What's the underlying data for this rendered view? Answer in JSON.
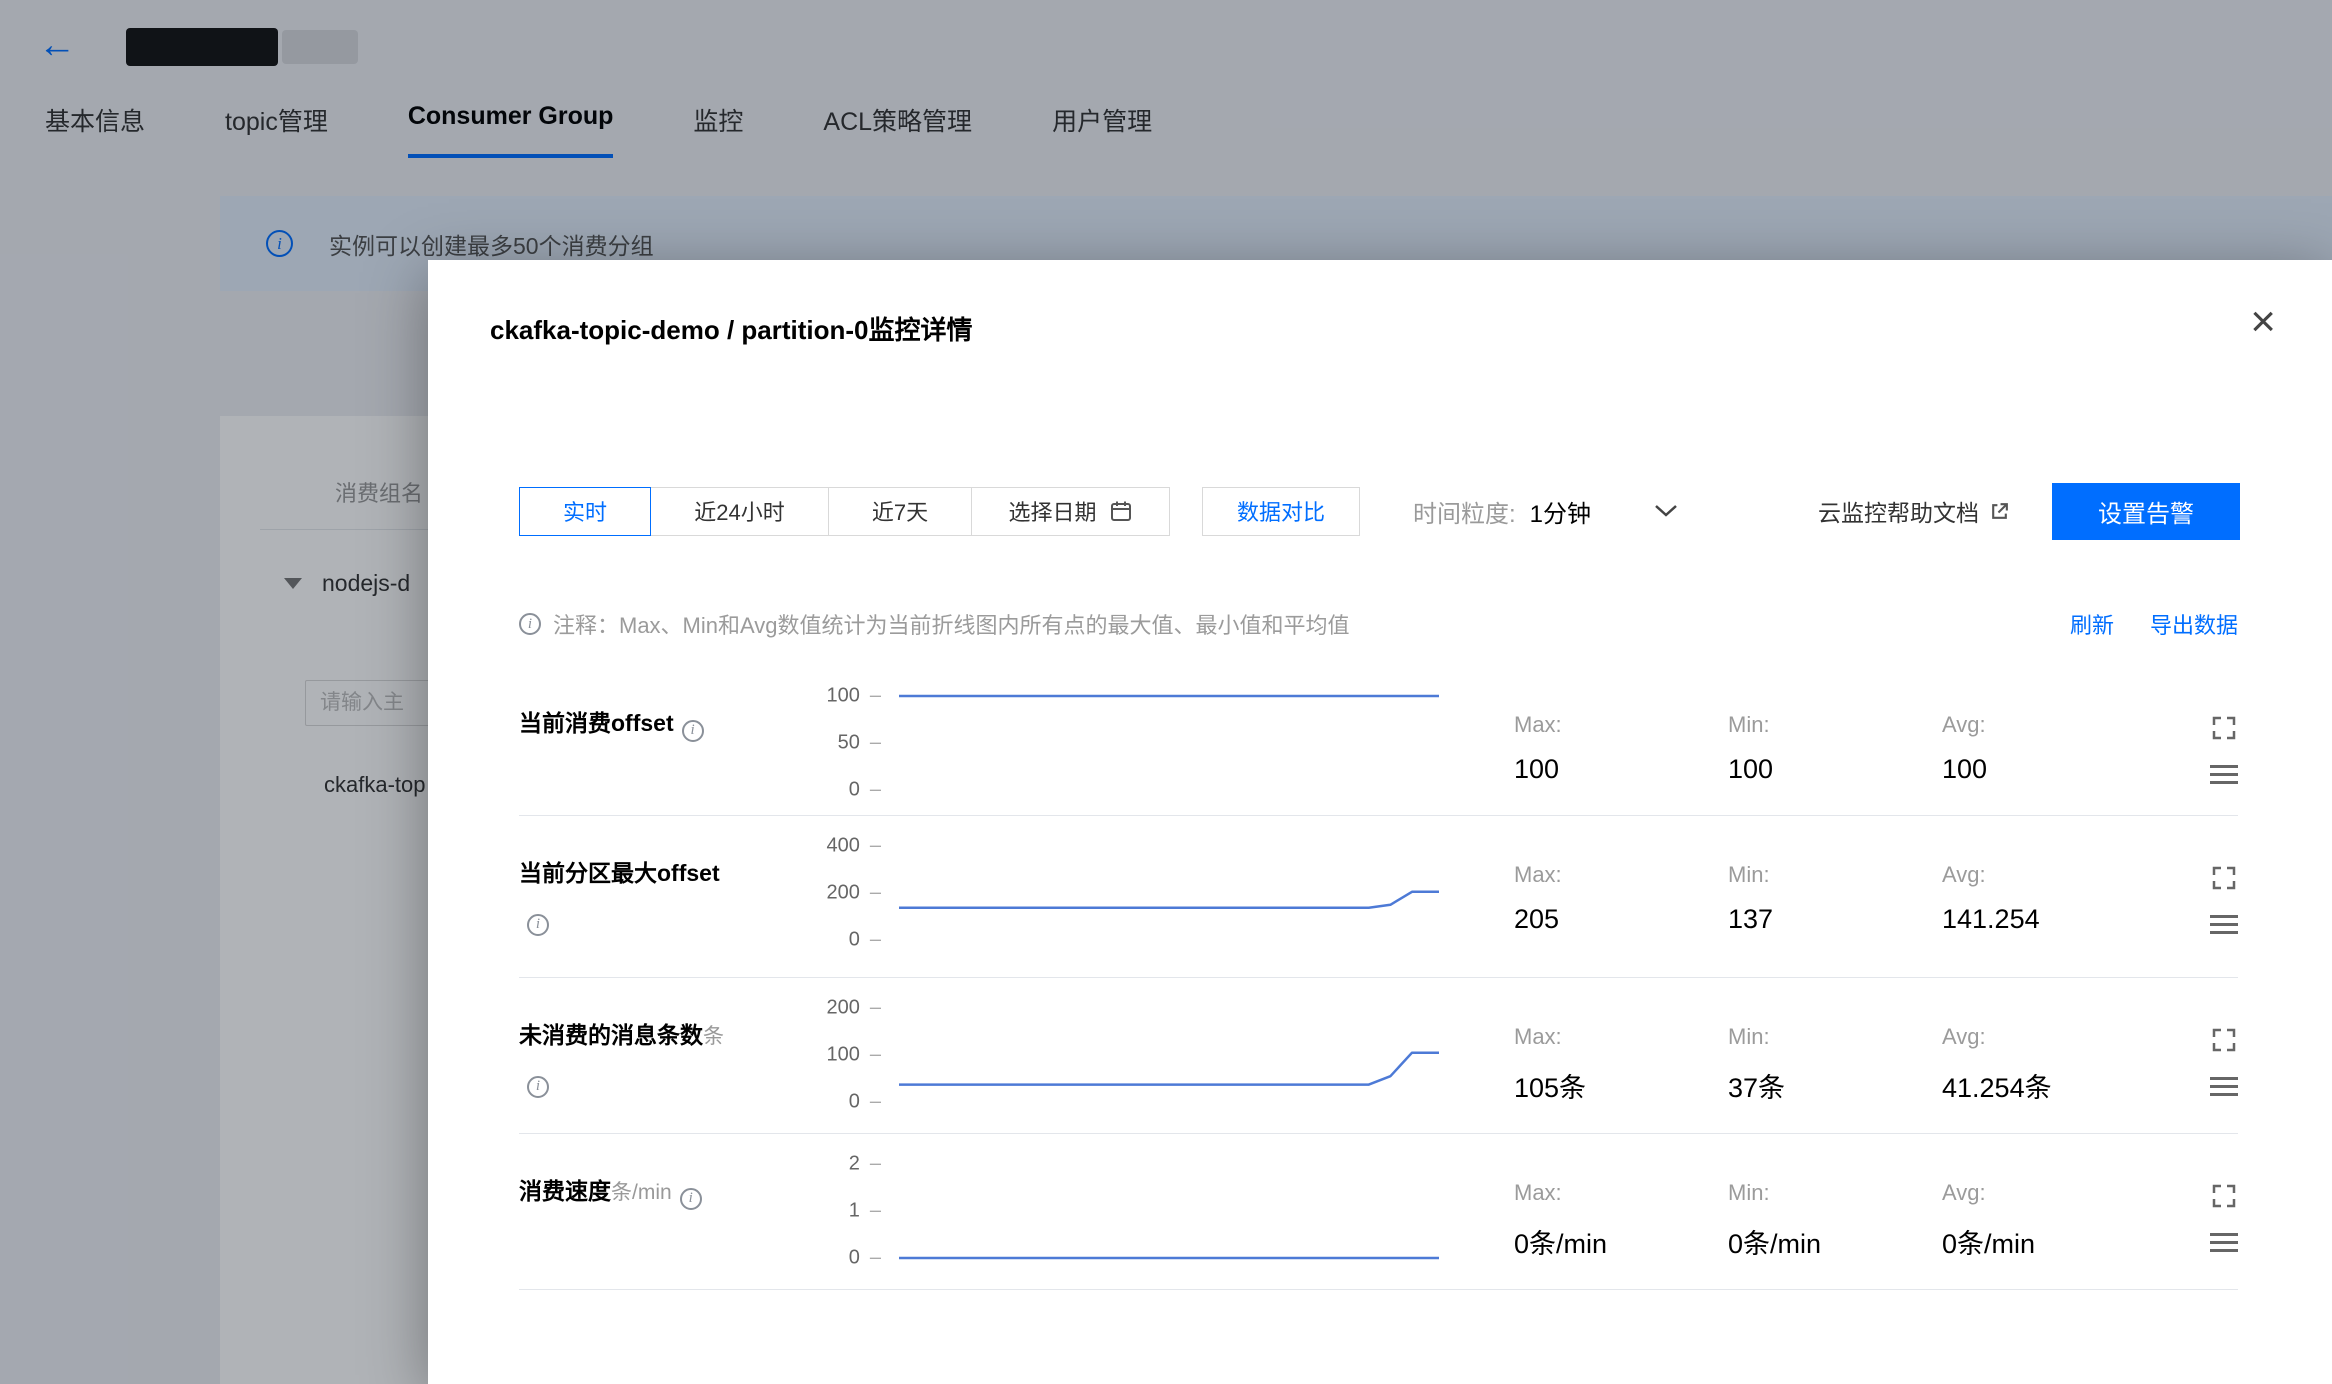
{
  "header": {
    "back_icon": "←",
    "tabs": [
      {
        "label": "基本信息"
      },
      {
        "label": "topic管理"
      },
      {
        "label": "Consumer Group"
      },
      {
        "label": "监控"
      },
      {
        "label": "ACL策略管理"
      },
      {
        "label": "用户管理"
      }
    ],
    "active_tab": "Consumer Group"
  },
  "banner": {
    "text": "实例可以创建最多50个消费分组"
  },
  "side_panel": {
    "group_label": "消费组名",
    "group_name": "nodejs-d",
    "search_placeholder": "请输入主",
    "topic_name": "ckafka-top"
  },
  "modal": {
    "title": "ckafka-topic-demo / partition-0监控详情",
    "close": "×",
    "time_ranges": [
      "实时",
      "近24小时",
      "近7天",
      "选择日期"
    ],
    "selected_range": "实时",
    "compare_button": "数据对比",
    "granularity_label": "时间粒度:",
    "granularity_value": "1分钟",
    "help_link": "云监控帮助文档",
    "alarm_button": "设置告警",
    "note": "注释：Max、Min和Avg数值统计为当前折线图内所有点的最大值、最小值和平均值",
    "refresh": "刷新",
    "export": "导出数据",
    "stat_labels": {
      "max": "Max:",
      "min": "Min:",
      "avg": "Avg:"
    },
    "accent_color": "#006eff"
  },
  "chart_data": [
    {
      "type": "line",
      "title": "当前消费offset",
      "unit": "",
      "yticks": [
        "100",
        "50",
        "0"
      ],
      "ylim": [
        0,
        100
      ],
      "x_range_norm": [
        0,
        1
      ],
      "points": [
        {
          "x": 0,
          "y": 100
        },
        {
          "x": 1,
          "y": 100
        }
      ],
      "stats": {
        "max": "100",
        "min": "100",
        "avg": "100"
      },
      "line_color": "#4d7ad6"
    },
    {
      "type": "line",
      "title": "当前分区最大offset",
      "unit": "",
      "yticks": [
        "400",
        "200",
        "0"
      ],
      "ylim": [
        0,
        400
      ],
      "x_range_norm": [
        0,
        1
      ],
      "points": [
        {
          "x": 0,
          "y": 137
        },
        {
          "x": 0.87,
          "y": 137
        },
        {
          "x": 0.91,
          "y": 150
        },
        {
          "x": 0.95,
          "y": 205
        },
        {
          "x": 1,
          "y": 205
        }
      ],
      "stats": {
        "max": "205",
        "min": "137",
        "avg": "141.254"
      },
      "line_color": "#4d7ad6"
    },
    {
      "type": "line",
      "title": "未消费的消息条数",
      "unit": "条",
      "yticks": [
        "200",
        "100",
        "0"
      ],
      "ylim": [
        0,
        200
      ],
      "x_range_norm": [
        0,
        1
      ],
      "points": [
        {
          "x": 0,
          "y": 37
        },
        {
          "x": 0.87,
          "y": 37
        },
        {
          "x": 0.91,
          "y": 55
        },
        {
          "x": 0.95,
          "y": 105
        },
        {
          "x": 1,
          "y": 105
        }
      ],
      "stats": {
        "max": "105条",
        "min": "37条",
        "avg": "41.254条"
      },
      "line_color": "#4d7ad6"
    },
    {
      "type": "line",
      "title": "消费速度",
      "unit": "条/min",
      "yticks": [
        "2",
        "1",
        "0"
      ],
      "ylim": [
        0,
        2
      ],
      "x_range_norm": [
        0,
        1
      ],
      "points": [
        {
          "x": 0,
          "y": 0
        },
        {
          "x": 1,
          "y": 0
        }
      ],
      "stats": {
        "max": "0条/min",
        "min": "0条/min",
        "avg": "0条/min"
      },
      "line_color": "#4d7ad6"
    }
  ]
}
